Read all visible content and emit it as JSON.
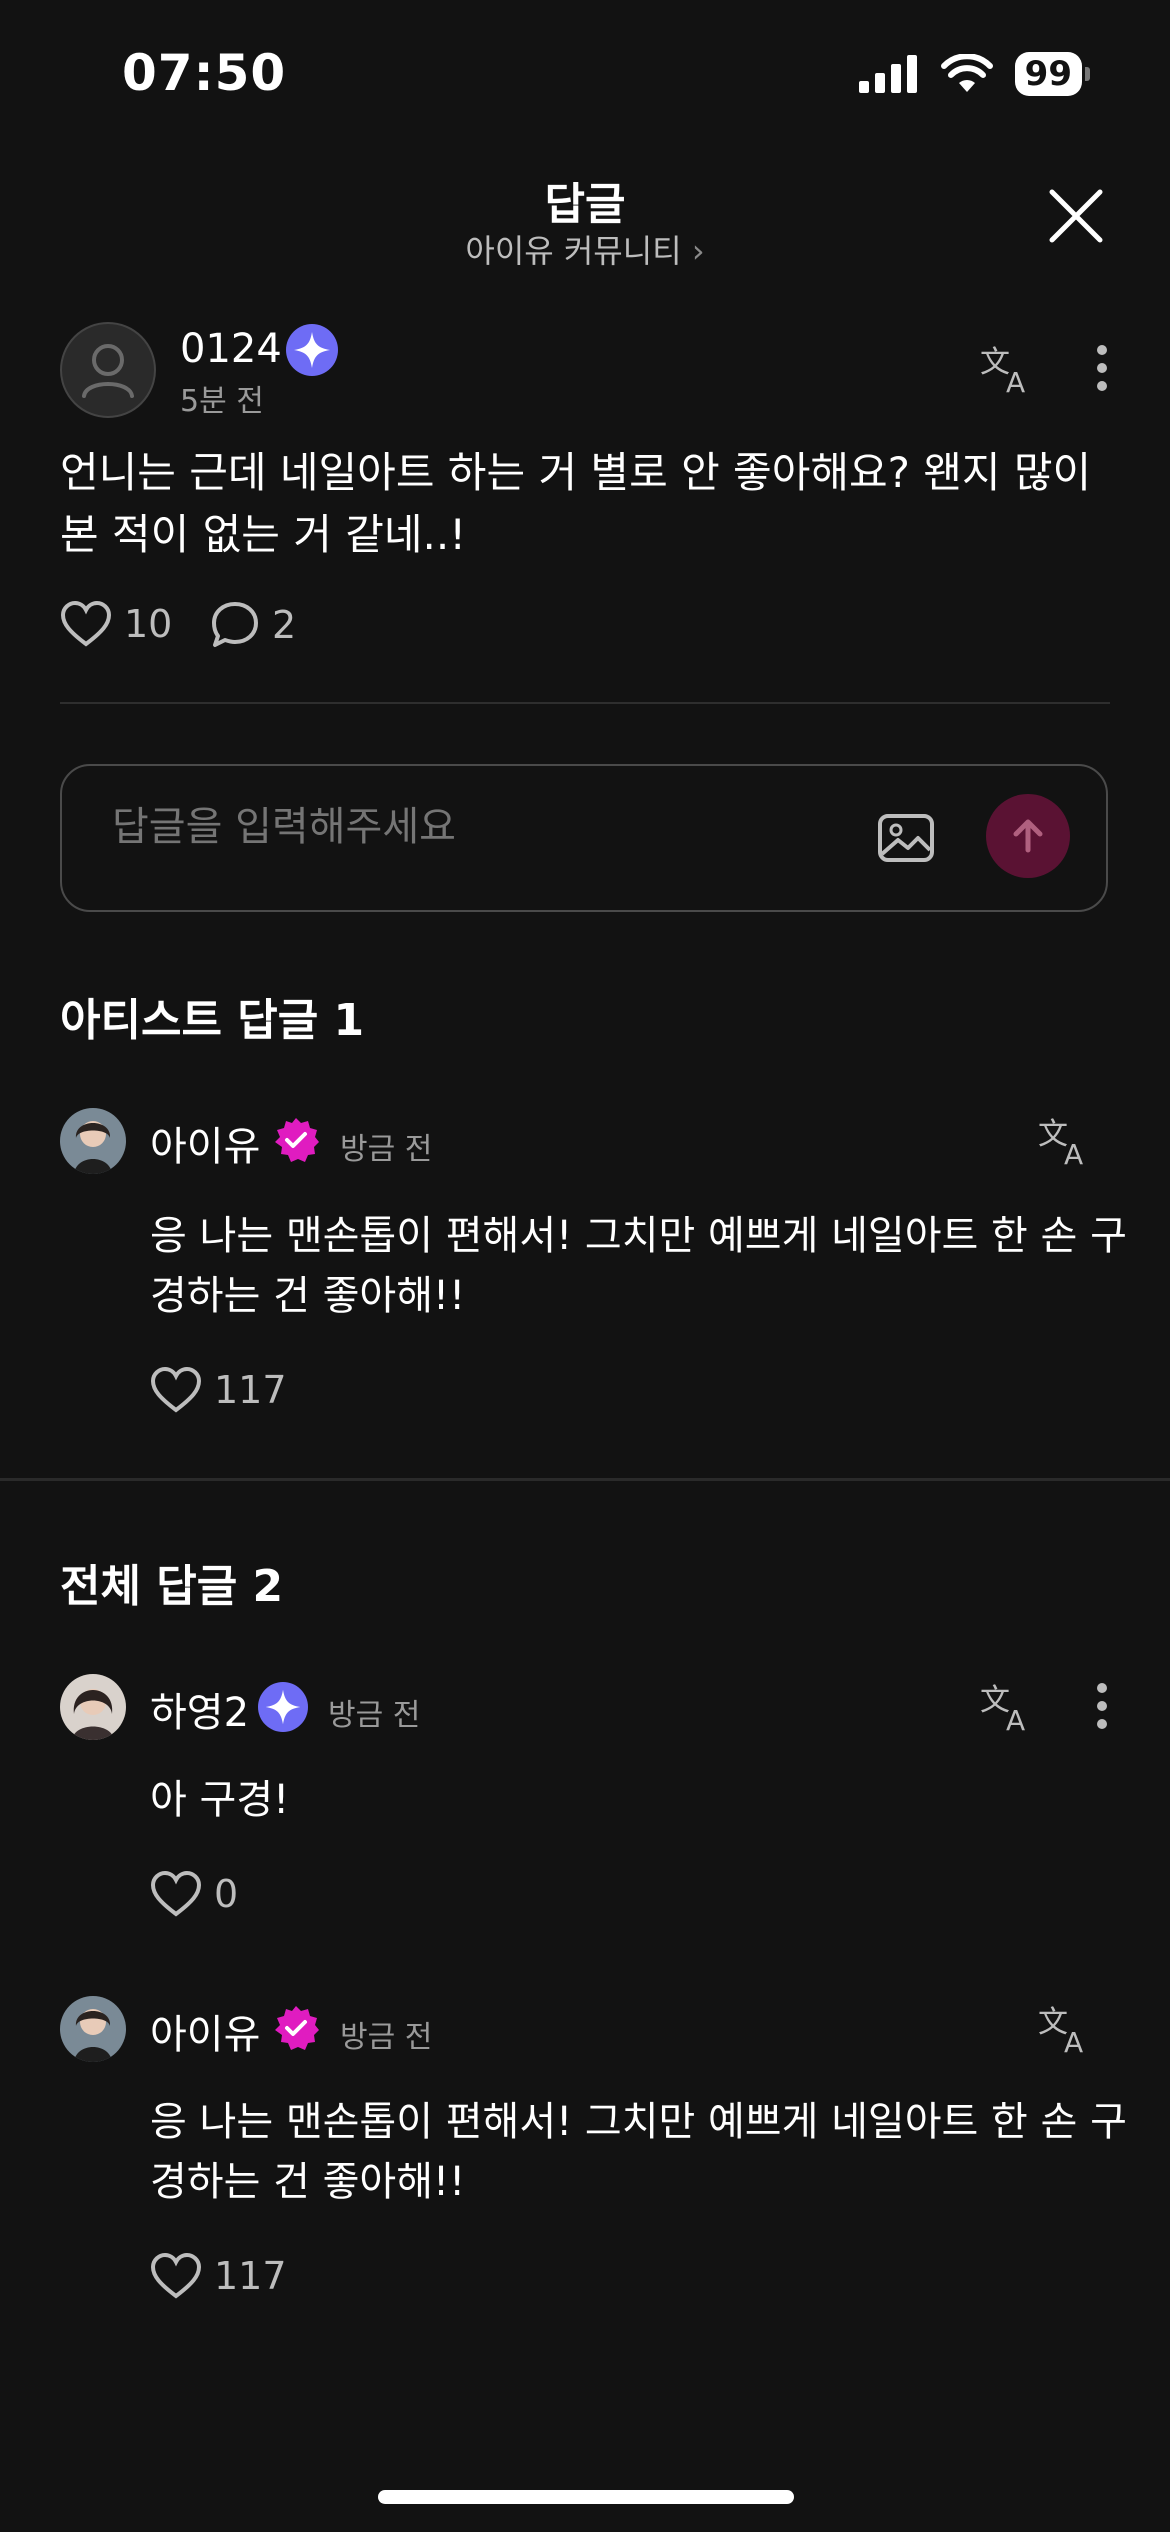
{
  "status_bar": {
    "time": "07:50",
    "battery": "99"
  },
  "header": {
    "title": "답글",
    "community": "아이유 커뮤니티",
    "community_arrow": "›"
  },
  "post": {
    "author": "0124",
    "time": "5분 전",
    "text": "언니는 근데 네일아트 하는 거 별로 안 좋아해요? 왠지 많이 본 적이 없는 거 같네..!",
    "likes": "10",
    "comments": "2"
  },
  "reply_input": {
    "placeholder": "답글을 입력해주세요"
  },
  "artist_section": {
    "title": "아티스트 답글 1",
    "replies": [
      {
        "author": "아이유",
        "time": "방금 전",
        "text": "응 나는 맨손톱이 편해서! 그치만 예쁘게 네일아트 한 손 구경하는 건 좋아해!!",
        "likes": "117"
      }
    ]
  },
  "all_section": {
    "title": "전체 답글 2",
    "replies": [
      {
        "author": "하영2",
        "time": "방금 전",
        "text": "아 구경!",
        "likes": "0"
      },
      {
        "author": "아이유",
        "time": "방금 전",
        "text": "응 나는 맨손톱이 편해서! 그치만 예쁘게 네일아트 한 손 구경하는 건 좋아해!!",
        "likes": "117"
      }
    ]
  },
  "colors": {
    "background": "#121212",
    "fan_badge": "#6e6cf5",
    "artist_badge": "#e01cc0",
    "send_button": "#5a1233"
  }
}
